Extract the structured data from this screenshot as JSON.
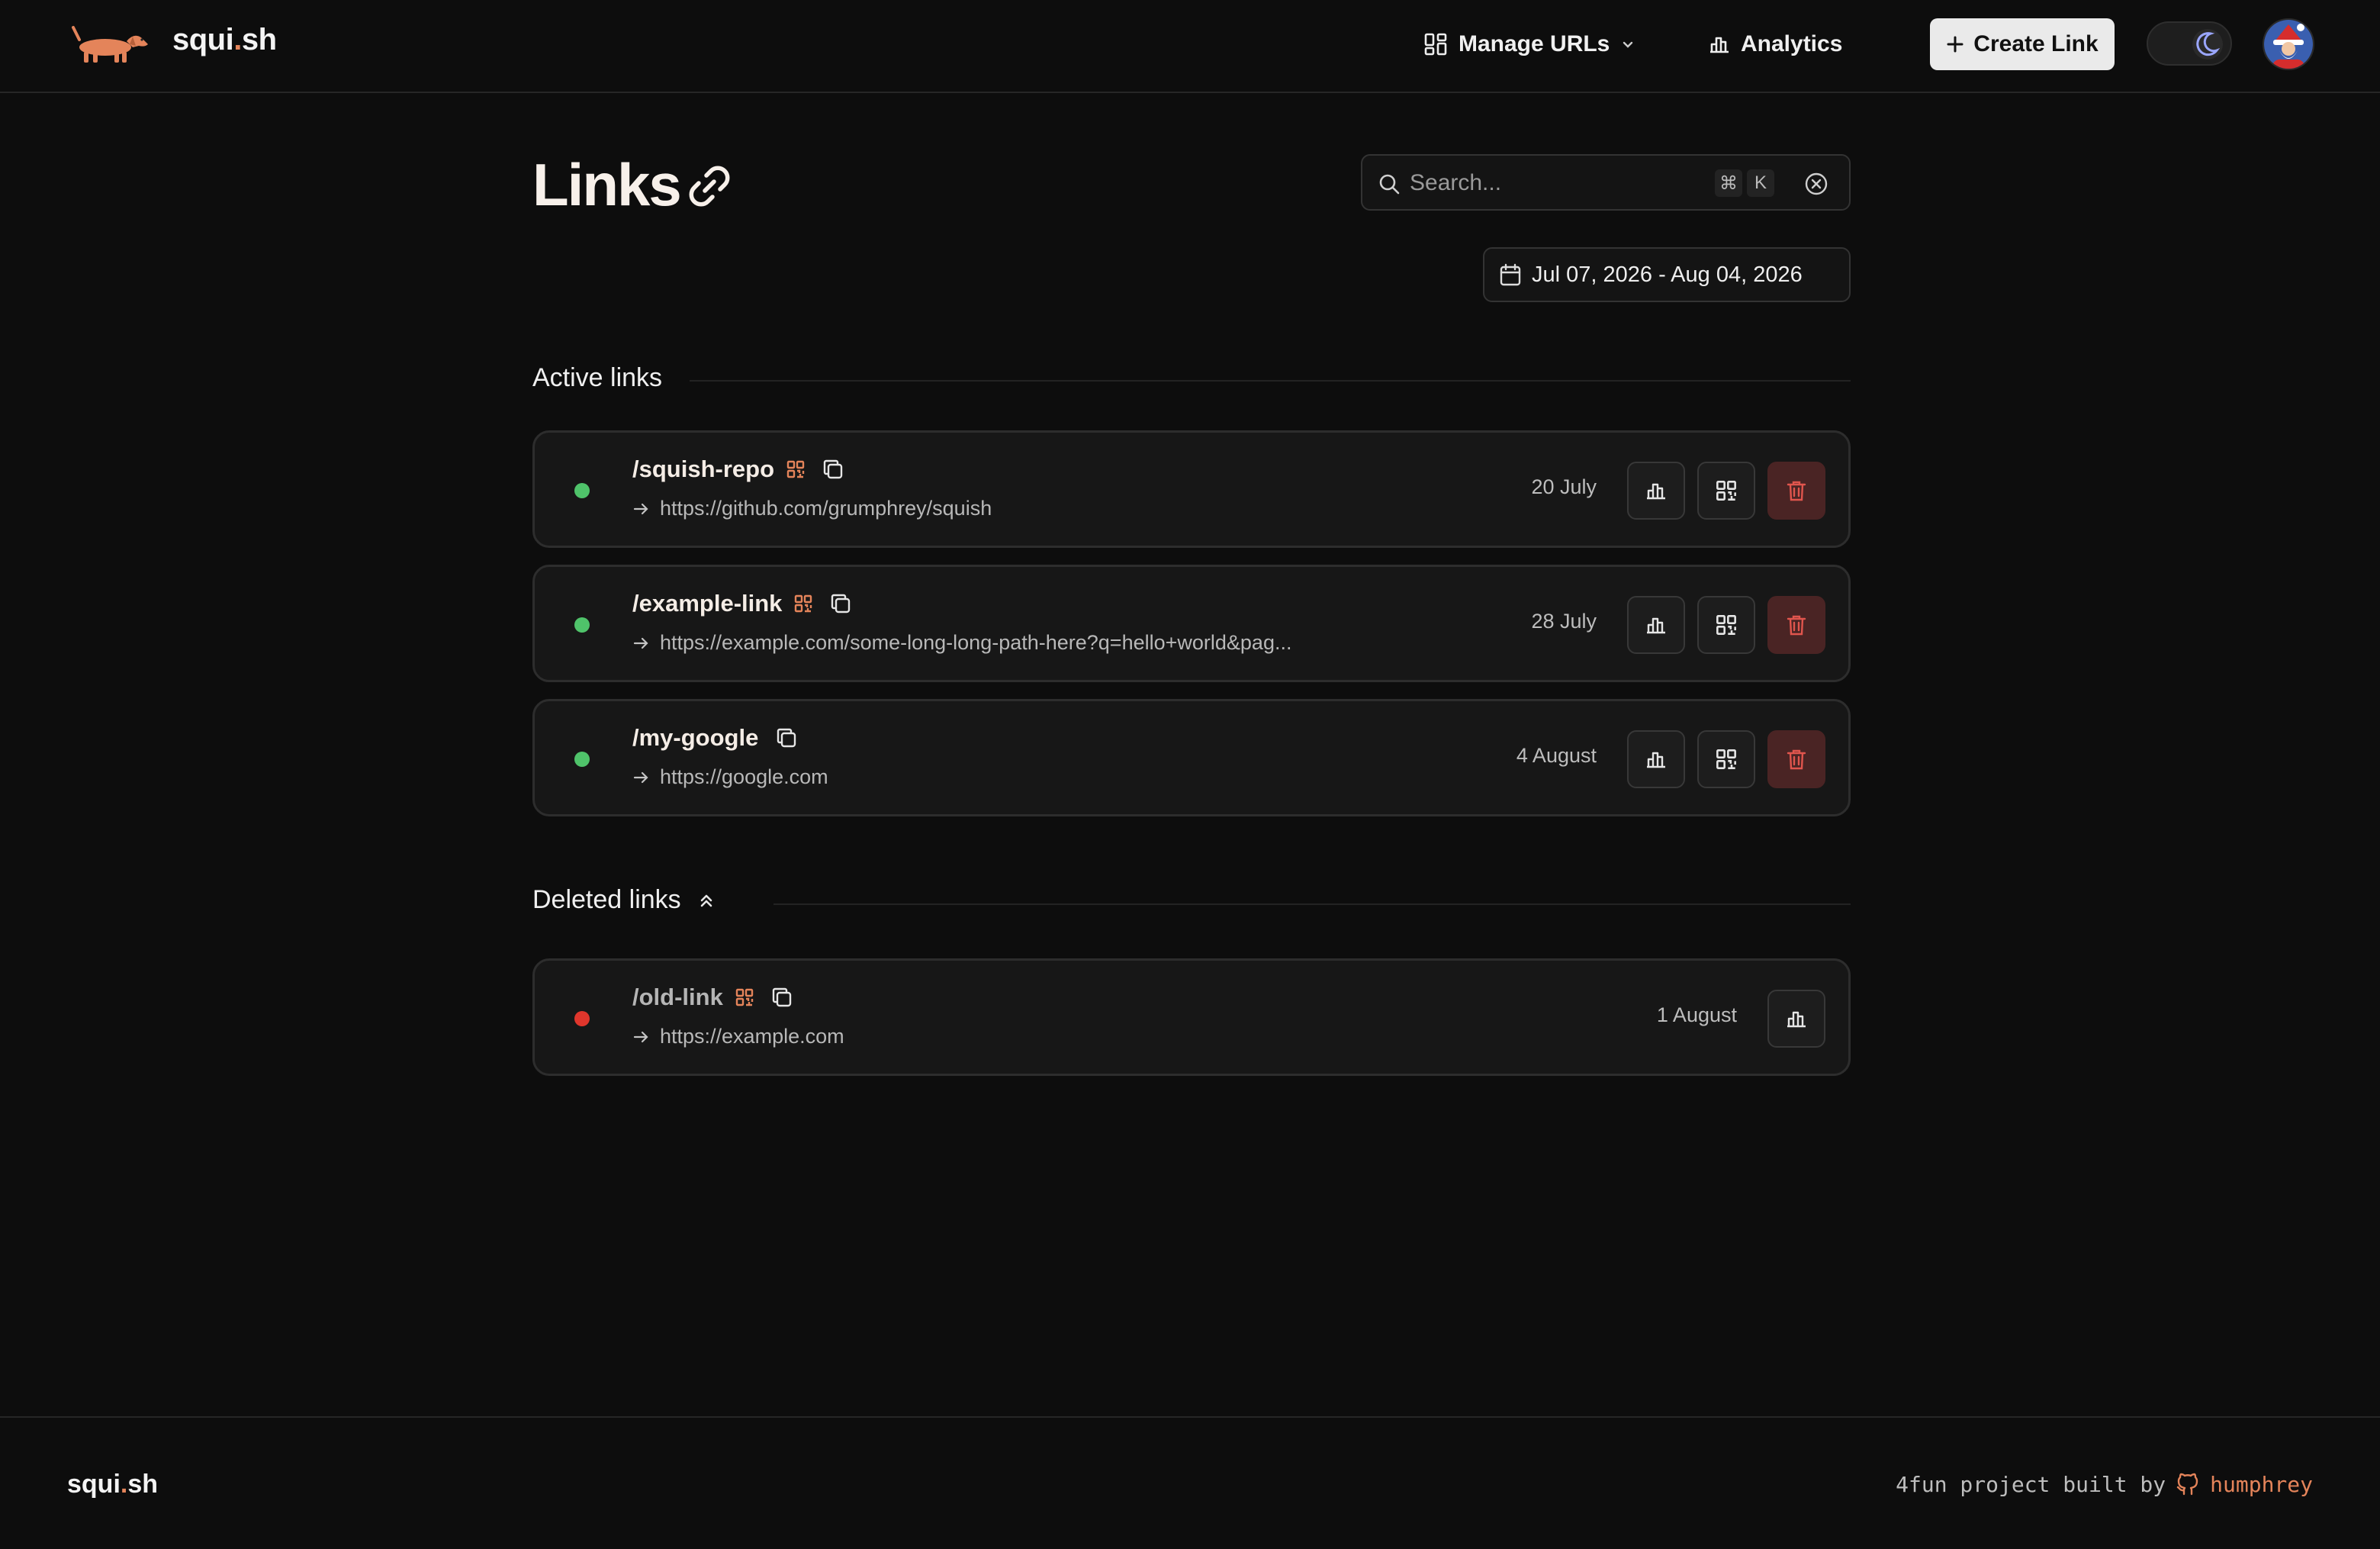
{
  "header": {
    "brand_prefix": "squi",
    "brand_dot": ".",
    "brand_suffix": "sh",
    "manage_urls": "Manage URLs",
    "analytics": "Analytics",
    "create_link": "Create Link"
  },
  "main": {
    "title": "Links",
    "search_placeholder": "Search...",
    "kbd_cmd": "⌘",
    "kbd_k": "K",
    "date_range": "Jul 07, 2026 - Aug 04, 2026"
  },
  "sections": {
    "active": "Active links",
    "deleted": "Deleted links"
  },
  "active_links": [
    {
      "slug": "/squish-repo",
      "url": "https://github.com/grumphrey/squish",
      "date": "20 July",
      "status": "active",
      "qr": true
    },
    {
      "slug": "/example-link",
      "url": "https://example.com/some-long-long-path-here?q=hello+world&pag...",
      "date": "28 July",
      "status": "active",
      "qr": true
    },
    {
      "slug": "/my-google",
      "url": "https://google.com",
      "date": "4 August",
      "status": "active",
      "qr": false
    }
  ],
  "deleted_links": [
    {
      "slug": "/old-link",
      "url": "https://example.com",
      "date": "1 August",
      "status": "deleted",
      "qr": true
    }
  ],
  "footer": {
    "brand_prefix": "squi",
    "brand_dot": ".",
    "brand_suffix": "sh",
    "credit": "4fun project built by",
    "author": "humphrey"
  },
  "colors": {
    "accent": "#e4845a",
    "status_active": "#4fc36a",
    "status_deleted": "#e0362c",
    "delete_bg": "#4a2424",
    "delete_icon": "#e0554d"
  },
  "icons": {
    "logo": "dachshund-logo-icon",
    "manage": "grid-icon",
    "analytics": "bar-chart-icon",
    "create": "plus-icon",
    "theme": "moon-icon",
    "title": "link-icon",
    "search": "search-icon",
    "clear": "clear-circle-icon",
    "date": "calendar-icon",
    "collapse": "chevrons-up-icon",
    "qr": "qr-code-icon",
    "copy": "copy-icon",
    "arrow": "arrow-right-icon",
    "delete": "trash-icon",
    "github": "github-icon"
  }
}
